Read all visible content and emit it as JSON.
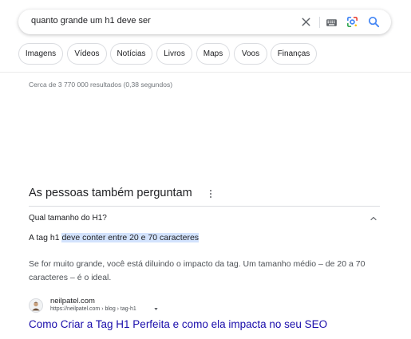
{
  "search": {
    "query": "quanto grande um h1 deve ser",
    "icons": [
      "close-icon",
      "keyboard-icon",
      "google-lens-icon",
      "search-icon"
    ]
  },
  "filters": [
    {
      "label": "Imagens"
    },
    {
      "label": "Vídeos"
    },
    {
      "label": "Notícias"
    },
    {
      "label": "Livros"
    },
    {
      "label": "Maps"
    },
    {
      "label": "Voos"
    },
    {
      "label": "Finanças"
    }
  ],
  "stats": {
    "text": "Cerca de 3 770 000 resultados (0,38 segundos)"
  },
  "paa": {
    "title": "As pessoas também perguntam",
    "question": "Qual tamanho do H1?",
    "answer_prefix": "A tag h1 ",
    "answer_highlight": "deve conter entre 20 e 70 caracteres",
    "answer_detail": "Se for muito grande, você está diluindo o impacto da tag. Um tamanho médio – de 20 a 70 caracteres – é o ideal.",
    "source": {
      "name": "neilpatel.com",
      "url": "https://neilpatel.com › blog › tag-h1"
    },
    "link_title": "Como Criar a Tag H1 Perfeita e como ela impacta no seu SEO"
  },
  "colors": {
    "link": "#1a0dab",
    "highlight": "#d3e3fd",
    "search_blue": "#4285f4"
  }
}
